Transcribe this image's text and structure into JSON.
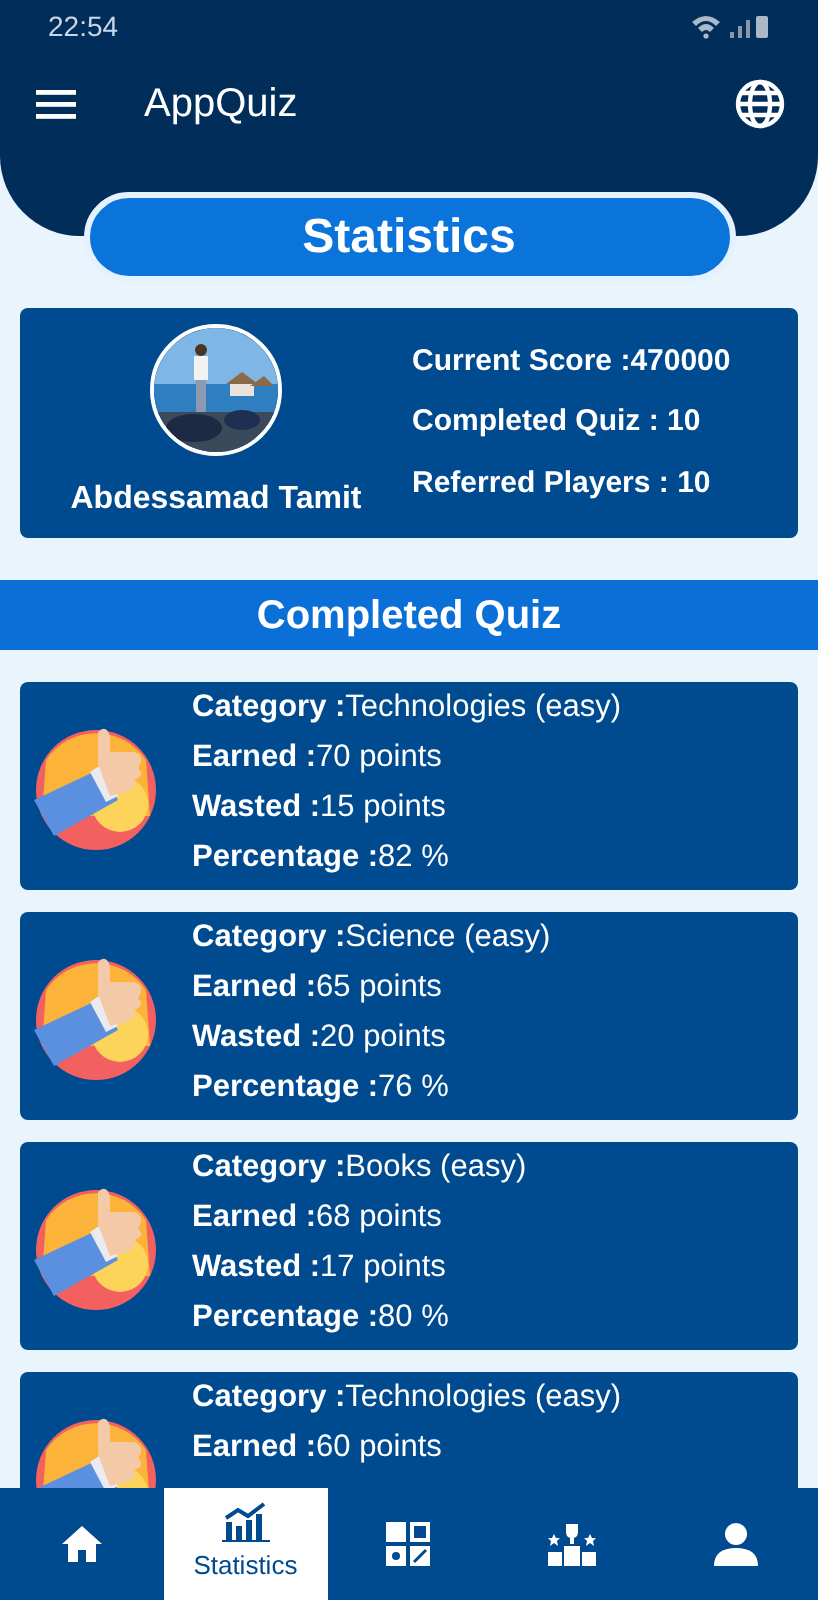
{
  "status_bar": {
    "time": "22:54"
  },
  "app_bar": {
    "title": "AppQuiz"
  },
  "page_title": "Statistics",
  "profile": {
    "name": "Abdessamad Tamit",
    "stats": [
      "Current Score :470000",
      "Completed Quiz : 10",
      "Referred Players : 10"
    ]
  },
  "section_title": "Completed Quiz",
  "quizzes": [
    {
      "lines": [
        "**Category :**Technologies (easy)",
        "**Earned :**70 points",
        "**Wasted :**15 points",
        "**Percentage :**82 %"
      ]
    },
    {
      "lines": [
        "**Category :**Science (easy)",
        "**Earned :**65 points",
        "**Wasted :**20 points",
        "**Percentage :**76 %"
      ]
    },
    {
      "lines": [
        "**Category :**Books (easy)",
        "**Earned :**68 points",
        "**Wasted :**17 points",
        "**Percentage :**80 %"
      ]
    },
    {
      "lines": [
        "**Category :**Technologies (easy)",
        "**Earned :**60 points"
      ]
    }
  ],
  "bottom_nav": [
    {
      "kind": "home",
      "selected": false
    },
    {
      "kind": "statistics",
      "label": "Statistics",
      "selected": true
    },
    {
      "kind": "categories",
      "selected": false
    },
    {
      "kind": "leaderboard",
      "selected": false
    },
    {
      "kind": "profile",
      "selected": false
    }
  ]
}
